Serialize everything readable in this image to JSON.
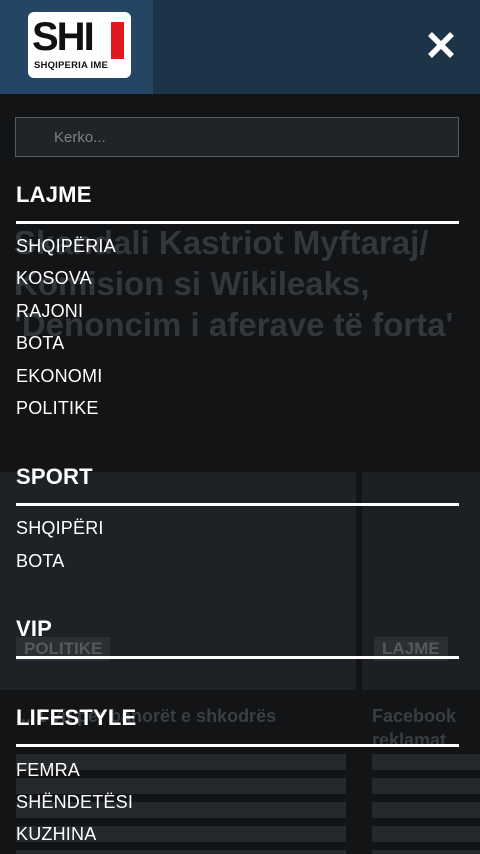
{
  "header": {
    "logo_text": "SHI",
    "logo_subtitle": "SHQIPERIA IME"
  },
  "search": {
    "placeholder": "Kerko..."
  },
  "menu": {
    "sections": [
      {
        "title": "LAJME",
        "items": [
          "SHQIPËRIA",
          "KOSOVA",
          "RAJONI",
          "BOTA",
          "EKONOMI",
          "POLITIKE"
        ]
      },
      {
        "title": "SPORT",
        "items": [
          "SHQIPËRI",
          "BOTA"
        ]
      },
      {
        "title": "VIP",
        "items": []
      },
      {
        "title": "LIFESTYLE",
        "items": [
          "FEMRA",
          "SHËNDETËSI",
          "KUZHINA"
        ]
      }
    ]
  },
  "background": {
    "headline": "Skandali Kastriot Myftaraj/ Komision si Wikileaks, 'Denoncim i aferave të forta'",
    "card1_tag": "POLITIKE",
    "card2_tag": "LAJME",
    "card1_title": "... 1 vit për banorët e shkodrës",
    "card2_title": "Facebook reklamat"
  },
  "colors": {
    "header_bg": "#1d3347",
    "logo_box_bg": "#244664",
    "overlay_bg": "#121416",
    "logo_accent": "#e0191e"
  }
}
